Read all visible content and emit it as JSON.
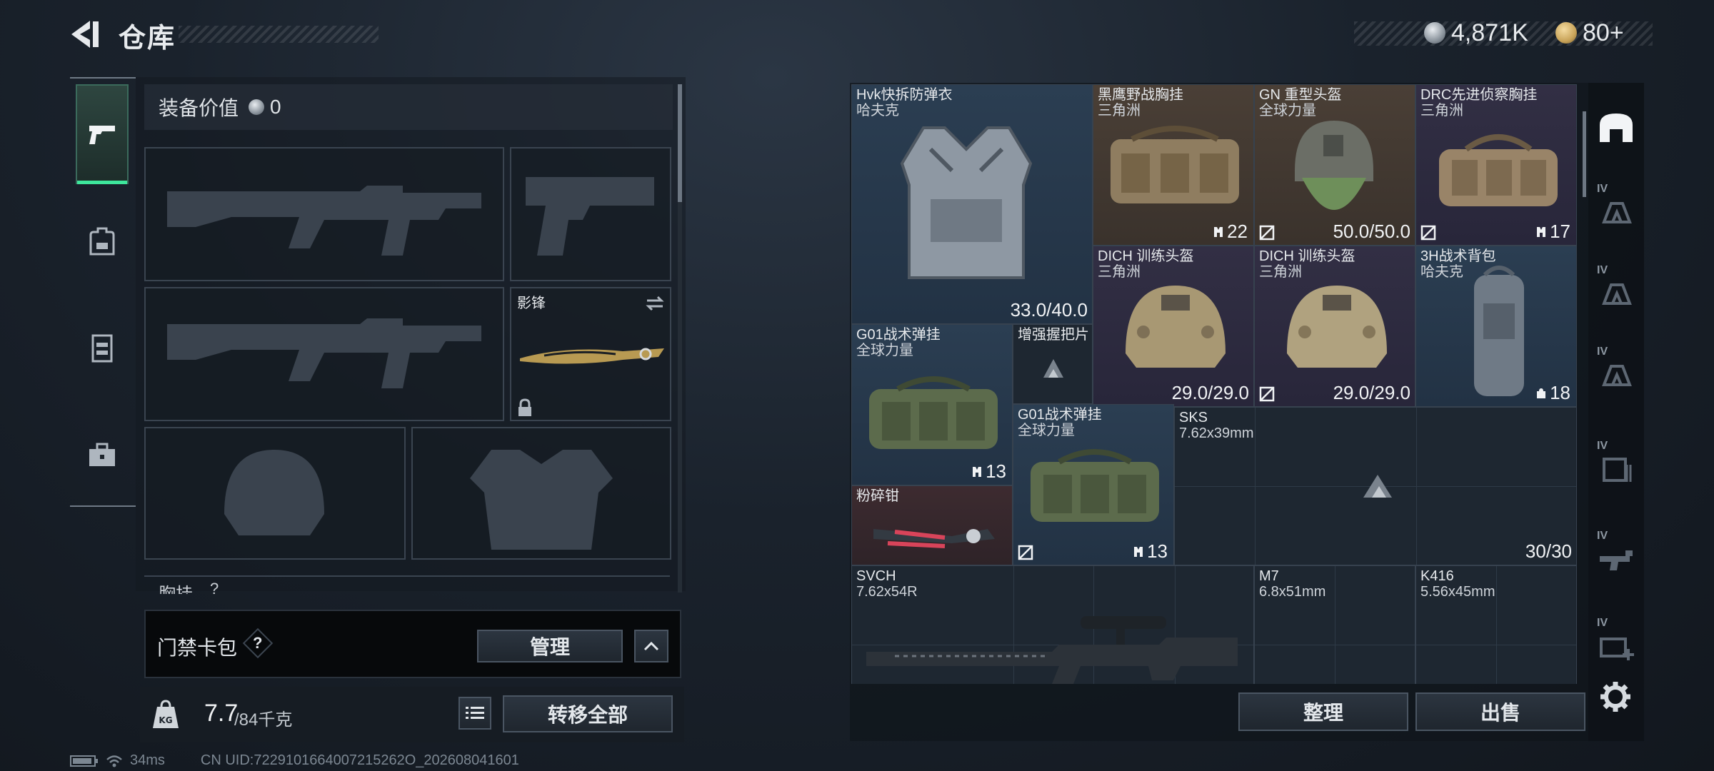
{
  "header": {
    "title": "仓库",
    "currency_value": "4,871K",
    "tickets_value": "80+"
  },
  "left_tabs": [
    "guns-tab",
    "backpack-tab",
    "chest-rig-tab",
    "case-tab"
  ],
  "equipment": {
    "value_label": "装备价值",
    "value": "0",
    "melee_name": "影锋",
    "chest_label": "胸挂",
    "chest_help": "?"
  },
  "keycard": {
    "label": "门禁卡包",
    "help": "?",
    "manage_button": "管理"
  },
  "weight": {
    "current": "7.7",
    "max": "/84千克",
    "kg_icon": "KG"
  },
  "buttons": {
    "transfer_all": "转移全部",
    "organize": "整理",
    "sell": "出售"
  },
  "items": [
    {
      "name": "Hvk快拆防弹衣",
      "sub": "哈夫克",
      "durability": "33.0/40.0"
    },
    {
      "name": "黑鹰野战胸挂",
      "sub": "三角洲",
      "count": "22"
    },
    {
      "name": "GN 重型头盔",
      "sub": "全球力量",
      "durability": "50.0/50.0"
    },
    {
      "name": "DRC先进侦察胸挂",
      "sub": "三角洲",
      "count": "17"
    },
    {
      "name": "DICH 训练头盔",
      "sub": "三角洲",
      "durability": "29.0/29.0"
    },
    {
      "name": "DICH 训练头盔",
      "sub": "三角洲",
      "durability": "29.0/29.0"
    },
    {
      "name": "3H战术背包",
      "sub": "哈夫克",
      "count": "18"
    },
    {
      "name": "G01战术弹挂",
      "sub": "全球力量",
      "count": "13"
    },
    {
      "name": "增强握把片",
      "sub": ""
    },
    {
      "name": "G01战术弹挂",
      "sub": "全球力量",
      "count": "13"
    },
    {
      "name": "SKS",
      "sub": "7.62x39mm",
      "ammo": "30/30"
    },
    {
      "name": "粉碎钳",
      "sub": ""
    },
    {
      "name": "SVCH",
      "sub": "7.62x54R"
    },
    {
      "name": "M7",
      "sub": "6.8x51mm"
    },
    {
      "name": "K416",
      "sub": "5.56x45mm"
    }
  ],
  "right_tabs": [
    "home-tab",
    "IV",
    "IV",
    "IV",
    "IV",
    "IV",
    "IV"
  ],
  "status": {
    "ping": "34ms",
    "uid": "CN UID:7229101664007215262O_202608041601"
  },
  "colors": {
    "accent": "#3ee69c",
    "gold_coin": "#c9a45a"
  }
}
